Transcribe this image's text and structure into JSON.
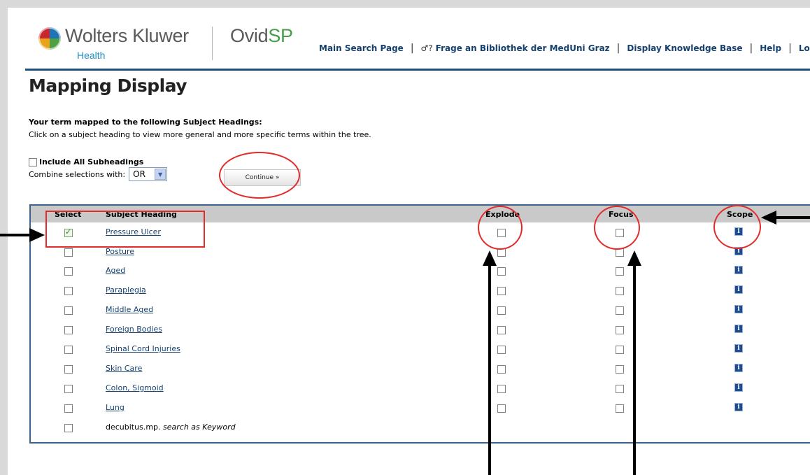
{
  "header": {
    "brand_name": "Wolters Kluwer",
    "brand_sub": "Health",
    "product_prefix": "Ovid",
    "product_suffix": "SP",
    "nav": [
      {
        "label": "Main Search Page"
      },
      {
        "label": "Frage an Bibliothek der MedUni Graz"
      },
      {
        "label": "Display Knowledge Base"
      },
      {
        "label": "Help"
      },
      {
        "label": "Logo"
      }
    ]
  },
  "page": {
    "title": "Mapping Display",
    "mapped_text": "Your term mapped to the following Subject Headings:",
    "instructions": "Click on a subject heading to view more general and more specific terms within the tree."
  },
  "options": {
    "include_all_label": "Include All Subheadings",
    "combine_label": "Combine selections with:",
    "combine_value": "OR",
    "continue_label": "Continue »"
  },
  "table": {
    "headers": {
      "select": "Select",
      "subject": "Subject Heading",
      "explode": "Explode",
      "focus": "Focus",
      "scope": "Scope"
    },
    "scope_icon": "i",
    "rows": [
      {
        "heading": "Pressure Ulcer",
        "checked": true
      },
      {
        "heading": "Posture",
        "checked": false
      },
      {
        "heading": "Aged",
        "checked": false
      },
      {
        "heading": "Paraplegia",
        "checked": false
      },
      {
        "heading": "Middle Aged",
        "checked": false
      },
      {
        "heading": "Foreign Bodies",
        "checked": false
      },
      {
        "heading": "Spinal Cord Injuries",
        "checked": false
      },
      {
        "heading": "Skin Care",
        "checked": false
      },
      {
        "heading": "Colon, Sigmoid",
        "checked": false
      },
      {
        "heading": "Lung",
        "checked": false
      }
    ],
    "keyword_row": {
      "term": "decubitus.mp.",
      "suffix": "search as Keyword"
    }
  },
  "colors": {
    "link": "#16416f",
    "header_rule": "#1d4f7e",
    "annotation": "#e22b2b",
    "arrow": "#000000"
  }
}
